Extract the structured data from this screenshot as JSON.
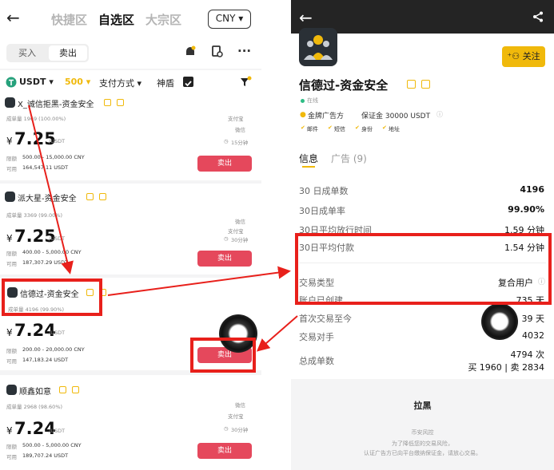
{
  "left": {
    "back": "←",
    "tabs": [
      "快捷区",
      "自选区",
      "大宗区"
    ],
    "currency": "CNY ▾",
    "segment": [
      "买入",
      "卖出"
    ],
    "filters": {
      "coin": "USDT ▾",
      "amount": "500 ▾",
      "pay": "支付方式 ▾",
      "shield": "神盾"
    },
    "icons": {
      "bell": "🔔",
      "more": "···"
    },
    "cards": [
      {
        "name": "X_诚信拒黑-资金安全",
        "stats": "成单量 1969 (100.00%)",
        "price": "7.25",
        "unit": "/USDT",
        "limit_lbl": "限额",
        "limit": "500.00 - 15,000.00 CNY",
        "avail_lbl": "可用",
        "avail": "164,547.11 USDT",
        "pay": [
          "支付宝",
          "微信"
        ],
        "time": "15分钟",
        "btn": "卖出"
      },
      {
        "name": "派大星-资金安全",
        "stats": "成单量 3369 (99.00%)",
        "price": "7.25",
        "unit": "/USDT",
        "limit_lbl": "限额",
        "limit": "400.00 - 5,000.00 CNY",
        "avail_lbl": "可用",
        "avail": "187,307.29 USDT",
        "pay": [
          "微信",
          "支付宝"
        ],
        "time": "30分钟",
        "btn": "卖出"
      },
      {
        "name": "信德过-资金安全",
        "stats": "成单量 4196 (99.90%)",
        "price": "7.24",
        "unit": "/USDT",
        "limit_lbl": "限额",
        "limit": "200.00 - 20,000.00 CNY",
        "avail_lbl": "可用",
        "avail": "147,183.24 USDT",
        "pay": [],
        "time": "",
        "btn": "卖出"
      },
      {
        "name": "顺鑫如意",
        "stats": "成单量 2968 (98.60%)",
        "price": "7.24",
        "unit": "/USDT",
        "limit_lbl": "限额",
        "limit": "500.00 - 5,000.00 CNY",
        "avail_lbl": "可用",
        "avail": "189,707.24 USDT",
        "pay": [
          "微信",
          "支付宝"
        ],
        "time": "30分钟",
        "btn": "卖出"
      }
    ]
  },
  "right": {
    "back": "←",
    "share": "⋖",
    "follow": "关注",
    "name": "信德过-资金安全",
    "online": "在线",
    "merchant": "金牌广告方",
    "deposit": "保证金 30000 USDT",
    "tags": [
      "邮件",
      "短信",
      "身份",
      "地址"
    ],
    "tabs": {
      "info": "信息",
      "ads": "广告 (9)"
    },
    "rows": [
      {
        "label": "30 日成单数",
        "value": "4196"
      },
      {
        "label": "30日成单率",
        "value": "99.90%"
      },
      {
        "label": "30日平均放行时间",
        "value": "1.59 分钟"
      },
      {
        "label": "30日平均付款",
        "value": "1.54 分钟"
      },
      {
        "label": "交易类型",
        "value": "复合用户"
      },
      {
        "label": "账户已创建",
        "value": "735 天"
      },
      {
        "label": "首次交易至今",
        "value": "39 天"
      },
      {
        "label": "交易对手",
        "value": "4032"
      },
      {
        "label": "总成单数",
        "value": "4794 次"
      }
    ],
    "total_split": "买 1960 | 卖 2834",
    "block": "拉黑",
    "footer": [
      "币安风控",
      "为了降低您的交易风险，",
      "认证广告方已向平台缴纳保证金，请放心交易。"
    ]
  },
  "colors": {
    "accent": "#f0b90b",
    "sell": "#e5485c",
    "annotation": "#e8201b"
  }
}
